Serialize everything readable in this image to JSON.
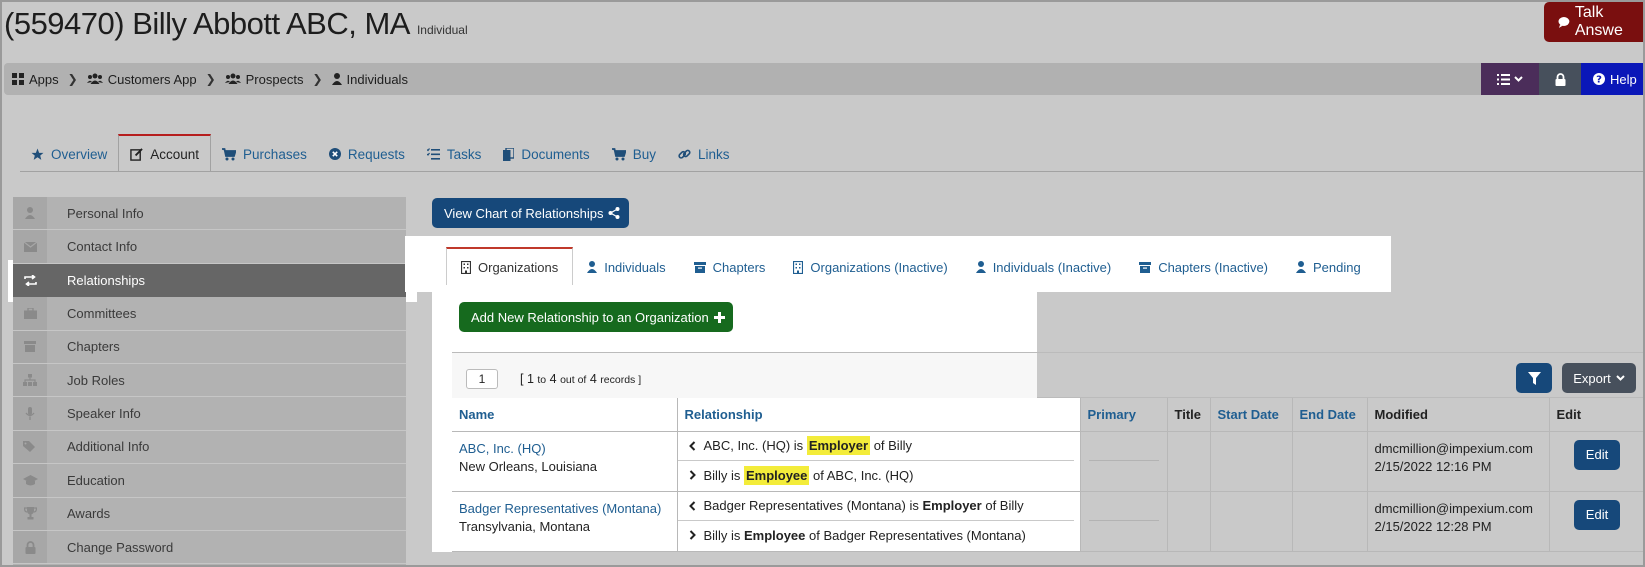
{
  "header": {
    "title": "(559470) Billy Abbott ABC, MA",
    "type": "Individual",
    "talk_label": "Talk Answe"
  },
  "breadcrumb": {
    "items": [
      "Apps",
      "Customers App",
      "Prospects",
      "Individuals"
    ],
    "help_label": "Help"
  },
  "main_tabs": [
    "Overview",
    "Account",
    "Purchases",
    "Requests",
    "Tasks",
    "Documents",
    "Buy",
    "Links"
  ],
  "sidebar": {
    "items": [
      "Personal Info",
      "Contact Info",
      "Relationships",
      "Committees",
      "Chapters",
      "Job Roles",
      "Speaker Info",
      "Additional Info",
      "Education",
      "Awards",
      "Change Password"
    ],
    "active": "Relationships"
  },
  "chart_button": "View Chart of Relationships",
  "sub_tabs": [
    "Organizations",
    "Individuals",
    "Chapters",
    "Organizations (Inactive)",
    "Individuals (Inactive)",
    "Chapters (Inactive)",
    "Pending"
  ],
  "add_button": "Add New Relationship to an Organization",
  "pager": {
    "page": "1",
    "records_open": "[ 1",
    "records_to": "to",
    "records_mid": "4",
    "records_outof": "out of",
    "records_total": "4",
    "records_end": "records ]"
  },
  "export_label": "Export",
  "table": {
    "headers": [
      "Name",
      "Relationship",
      "Primary",
      "Title",
      "Start Date",
      "End Date",
      "Modified",
      "Edit"
    ],
    "rows": [
      {
        "name": "ABC, Inc. (HQ)",
        "location": "New Orleans, Louisiana",
        "rel1_a": "ABC, Inc. (HQ) is",
        "rel1_b": "Employer",
        "rel1_c": "of Billy",
        "rel2_a": "Billy is",
        "rel2_b": "Employee",
        "rel2_c": "of ABC, Inc. (HQ)",
        "modified_by": "dmcmillion@impexium.com",
        "modified_at": "2/15/2022 12:16 PM",
        "edit": "Edit"
      },
      {
        "name": "Badger Representatives (Montana)",
        "location": "Transylvania, Montana",
        "rel1_a": "Badger Representatives (Montana) is",
        "rel1_b": "Employer",
        "rel1_c": "of Billy",
        "rel2_a": "Billy is",
        "rel2_b": "Employee",
        "rel2_c": "of Badger Representatives (Montana)",
        "modified_by": "dmcmillion@impexium.com",
        "modified_at": "2/15/2022 12:28 PM",
        "edit": "Edit"
      }
    ]
  },
  "colors": {
    "link": "#1f5e91",
    "primary_button": "#16487a",
    "success_button": "#166a1e",
    "highlight": "#f3ec3a",
    "talk": "#7a0f0f"
  }
}
